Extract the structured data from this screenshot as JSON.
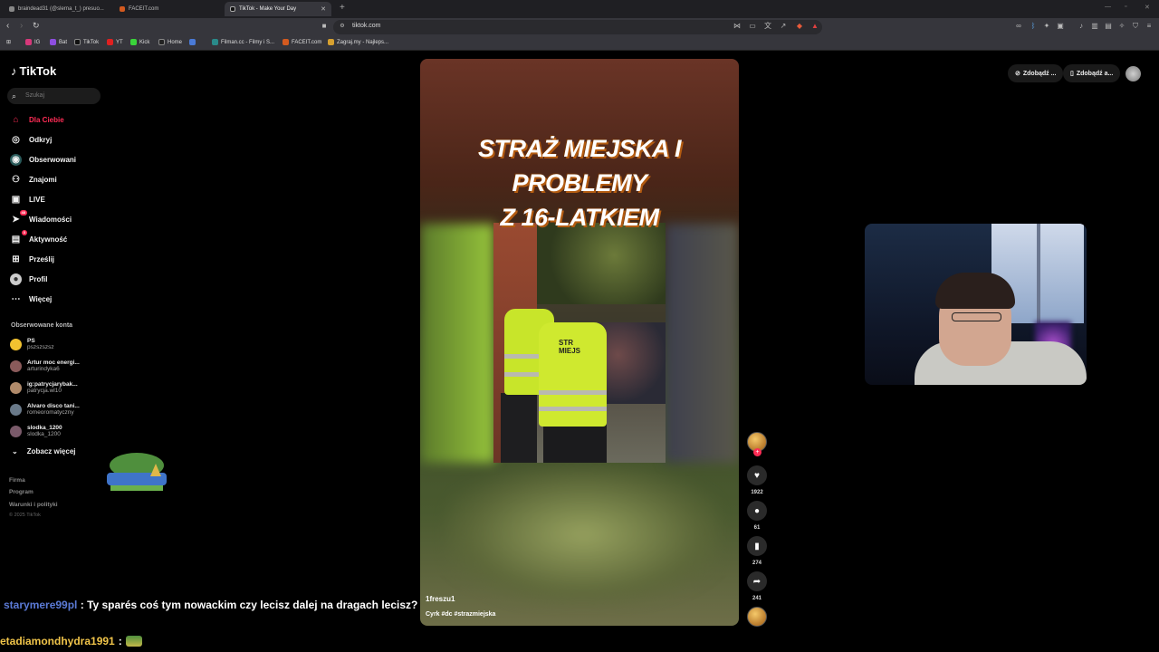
{
  "browser": {
    "tabs": [
      {
        "label": "braindead31 (@slerna_t_) presuo...",
        "active": false
      },
      {
        "label": "FACEIT.com",
        "active": false
      },
      {
        "label": "TikTok - Make Your Day",
        "active": true
      }
    ],
    "new_tab": "+",
    "url": "tiktok.com",
    "bookmarks": [
      "IG",
      "Bat",
      "TikTok",
      "YT",
      "Kick",
      "Home",
      "",
      "Filman.cc - Filmy i S...",
      "FACEIT.com",
      "Zagraj.my - Najleps..."
    ]
  },
  "tiktok": {
    "logo": "TikTok",
    "search_placeholder": "Szukaj",
    "nav": [
      {
        "label": "Dla Ciebie",
        "icon": "home-icon",
        "active": true
      },
      {
        "label": "Odkryj",
        "icon": "compass-icon",
        "active": false
      },
      {
        "label": "Obserwowani",
        "icon": "following-icon",
        "active": false
      },
      {
        "label": "Znajomi",
        "icon": "friends-icon",
        "active": false
      },
      {
        "label": "LIVE",
        "icon": "live-icon",
        "active": false
      },
      {
        "label": "Wiadomości",
        "icon": "messages-icon",
        "active": false,
        "badge": "48"
      },
      {
        "label": "Aktywność",
        "icon": "activity-icon",
        "active": false,
        "badge": "3"
      },
      {
        "label": "Prześlij",
        "icon": "upload-icon",
        "active": false
      },
      {
        "label": "Profil",
        "icon": "profile-icon",
        "active": false
      },
      {
        "label": "Więcej",
        "icon": "more-icon",
        "active": false
      }
    ],
    "followed_title": "Obserwowane konta",
    "accounts": [
      {
        "name": "PS",
        "handle": "pszszszsz",
        "color": "#f2c230"
      },
      {
        "name": "Artur moc energi...",
        "handle": "arturindyka6",
        "color": "#8a5a5a"
      },
      {
        "name": "ig:patrycjarybak...",
        "handle": "patrycja.wl10",
        "color": "#b08a6a"
      },
      {
        "name": "Alvaro disco tani...",
        "handle": "romeoromatyczny",
        "color": "#6a7a8a"
      },
      {
        "name": "slodka_1200",
        "handle": "slodka_1200",
        "color": "#7a5a6a"
      }
    ],
    "see_more": "Zobacz więcej",
    "footer": [
      "Firma",
      "Program",
      "Warunki i polityki"
    ],
    "copyright": "© 2025 TikTok",
    "top_right": [
      "Zdobądź ...",
      "Zdobądź a..."
    ]
  },
  "video": {
    "headline_line1": "STRAŻ MIEJSKA I PROBLEMY",
    "headline_line2": "Z 16-LATKIEM",
    "vest_text": "STR\nMIEJS",
    "author": "1freszu1",
    "caption": "Cyrk #dc #strazmiejska",
    "likes": "1922",
    "comments": "61",
    "saves": "274",
    "shares": "241"
  },
  "chat": [
    {
      "user": "starymere99pl",
      "text": ": Ty sparés coś tym nowackim czy lecisz dalej na dragach lecisz?"
    },
    {
      "user": "etadiamondhydra1991",
      "text": ":"
    }
  ]
}
